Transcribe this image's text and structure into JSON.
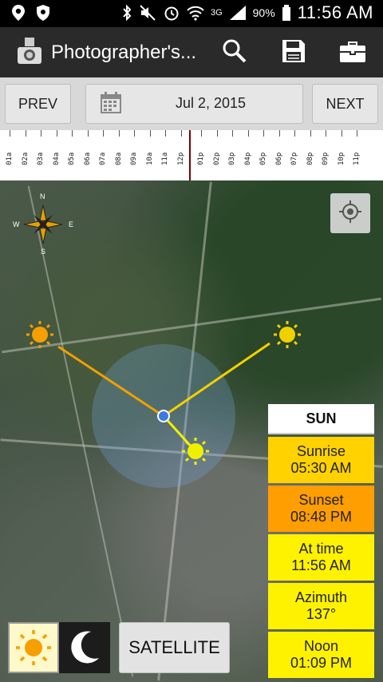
{
  "status_bar": {
    "network": "3G",
    "battery": "90%",
    "time": "11:56 AM"
  },
  "action_bar": {
    "title": "Photographer's...",
    "icons": [
      "camera-app-icon",
      "search-icon",
      "save-icon",
      "briefcase-icon"
    ]
  },
  "date_bar": {
    "prev_label": "PREV",
    "date": "Jul 2, 2015",
    "next_label": "NEXT"
  },
  "ruler": {
    "labels_left": [
      "01a",
      "02a",
      "03a",
      "04a",
      "05a",
      "06a",
      "07a",
      "08a",
      "09a",
      "10a",
      "11a",
      "12p"
    ],
    "labels_right": [
      "01p",
      "02p",
      "03p",
      "04p",
      "05p",
      "06p",
      "07p",
      "08p",
      "09p",
      "10p",
      "11p"
    ]
  },
  "map": {
    "compass": {
      "n": "N",
      "s": "S",
      "e": "E",
      "w": "W"
    }
  },
  "sun_panel": {
    "header": "SUN",
    "items": [
      {
        "label": "Sunrise",
        "value": "05:30 AM"
      },
      {
        "label": "Sunset",
        "value": "08:48 PM"
      },
      {
        "label": "At time",
        "value": "11:56 AM"
      },
      {
        "label": "Azimuth",
        "value": "137°"
      },
      {
        "label": "Noon",
        "value": "01:09 PM"
      }
    ]
  },
  "bottom": {
    "satellite_label": "SATELLITE"
  },
  "colors": {
    "sunrise": "#ffd200",
    "sunset": "#ff9e00",
    "sun_lines": "#f2c200",
    "location": "#3b7ae0"
  }
}
